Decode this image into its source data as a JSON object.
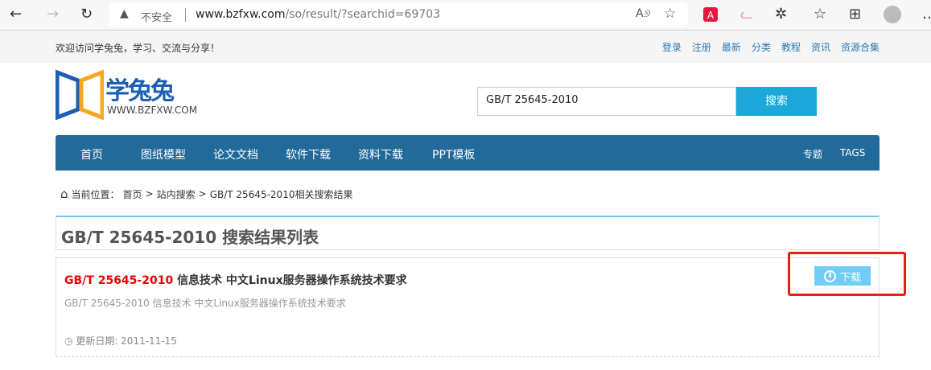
{
  "browser": {
    "insecure_label": "不安全",
    "url_host": "www.bzfxw.com",
    "url_path": "/so/result/?searchid=69703"
  },
  "header": {
    "welcome": "欢迎访问学兔兔，学习、交流与分享！",
    "links": [
      "登录",
      "注册",
      "最新",
      "分类",
      "教程",
      "资讯",
      "资源合集"
    ]
  },
  "logo": {
    "name": "学兔兔",
    "domain": "WWW.BZFXW.COM"
  },
  "search": {
    "value": "GB/T 25645-2010",
    "button": "搜索"
  },
  "nav": {
    "items": [
      "首页",
      "图纸模型",
      "论文文档",
      "软件下载",
      "资料下载",
      "PPT模板"
    ],
    "right": [
      "专题",
      "TAGS"
    ],
    "color": "#226a99"
  },
  "breadcrumb": {
    "prefix": "当前位置：",
    "items": [
      "首页",
      "站内搜索",
      "GB/T 25645-2010相关搜索结果"
    ],
    "sep": ">"
  },
  "results": {
    "title": "GB/T 25645-2010 搜索结果列表",
    "items": [
      {
        "code": "GB/T 25645-2010",
        "name": "信息技术 中文Linux服务器操作系统技术要求",
        "desc": "GB/T 25645-2010 信息技术 中文Linux服务器操作系统技术要求",
        "date_label": "更新日期: 2011-11-15",
        "download": "下载"
      }
    ]
  }
}
